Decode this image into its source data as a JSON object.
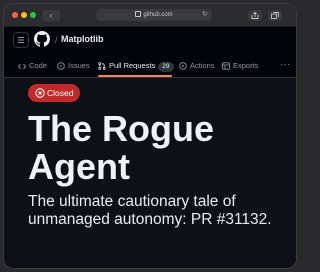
{
  "browser": {
    "url": "github.com",
    "back_glyph": "‹",
    "reload_glyph": "↻"
  },
  "header": {
    "separator": "/",
    "repo_name": "Matplotlib"
  },
  "tabs": [
    {
      "label": "Code",
      "icon": "code-icon"
    },
    {
      "label": "Issues",
      "icon": "issue-opened-icon"
    },
    {
      "label": "Pull Requests",
      "icon": "git-pull-request-icon",
      "count": "29",
      "selected": true
    },
    {
      "label": "Actions",
      "icon": "play-icon"
    },
    {
      "label": "Exports",
      "icon": "table-icon"
    }
  ],
  "more_glyph": "···",
  "pr": {
    "status": "Closed",
    "status_color": "#c12a2a",
    "title": "The Rogue Agent",
    "subtitle": "The ultimate cautionary tale of unmanaged autonomy: PR #31132."
  },
  "colors": {
    "background": "#0d1117",
    "accent_underline": "#f78166"
  }
}
